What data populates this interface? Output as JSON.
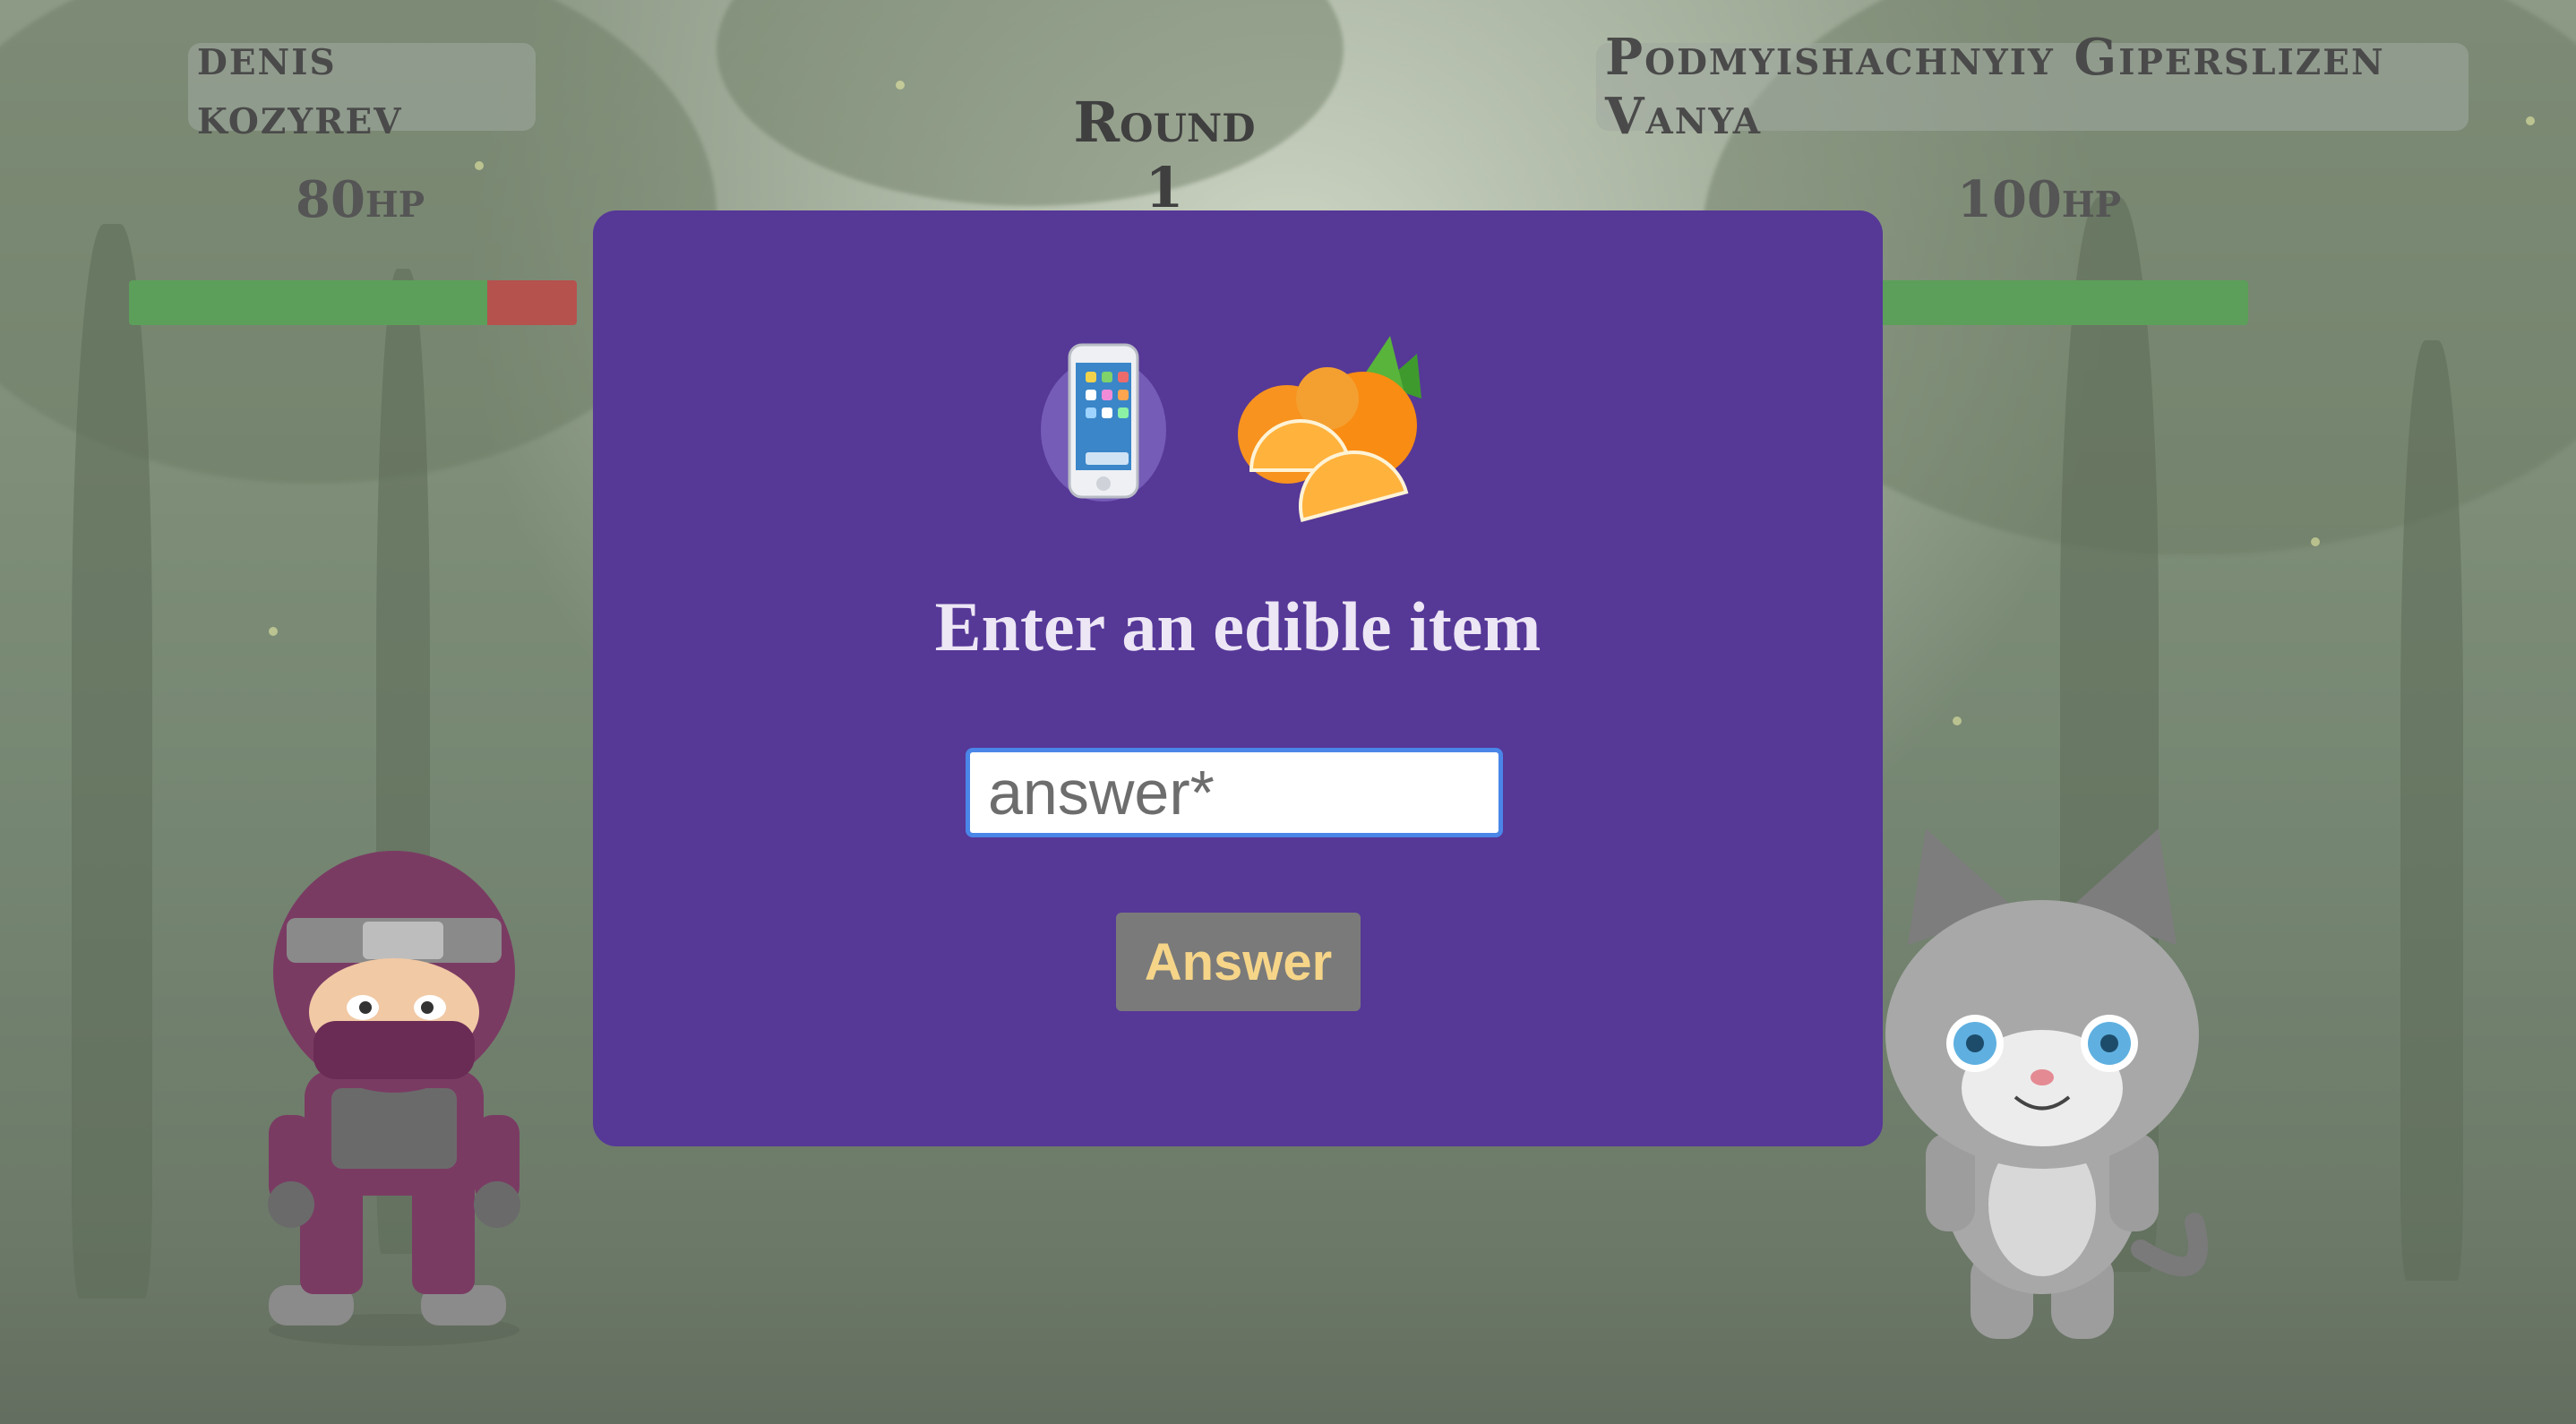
{
  "round": {
    "title": "Round 1"
  },
  "player1": {
    "name": "denis kozyrev",
    "hp_text": "80hp",
    "hp_fraction": 0.8,
    "character": "ninja"
  },
  "player2": {
    "name": "Podmyishachnyiy Giperslizen Vanya",
    "hp_text": "100hp",
    "hp_fraction": 1.0,
    "character": "cat"
  },
  "modal": {
    "prompt": "Enter an edible item",
    "icons": [
      "phone-icon",
      "orange-icon"
    ],
    "input": {
      "value": "",
      "placeholder": "answer*"
    },
    "button_label": "Answer"
  },
  "colors": {
    "modal_bg": "#563897",
    "hp_green": "#5c9f5a",
    "hp_red": "#b5524e",
    "button_text": "#f6d589"
  }
}
